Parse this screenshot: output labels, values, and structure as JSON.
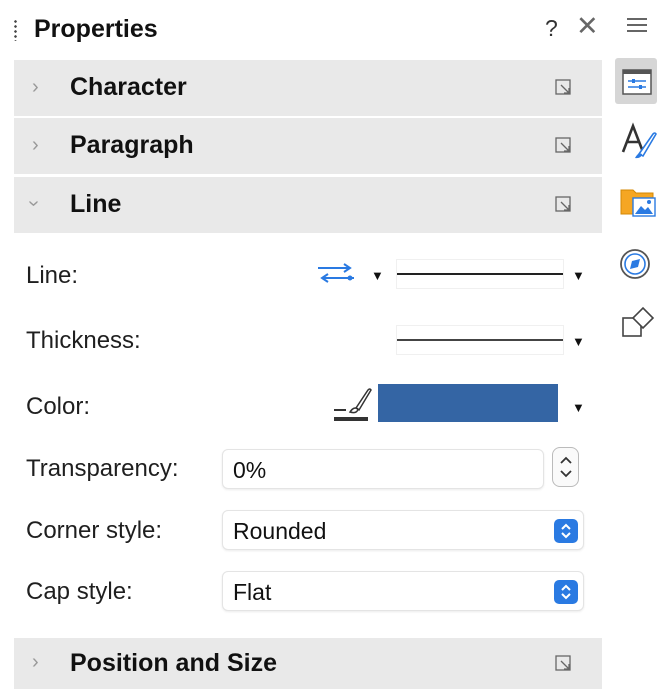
{
  "panel": {
    "title": "Properties",
    "help_label": "?",
    "close_label": "✕"
  },
  "sections": {
    "character": "Character",
    "paragraph": "Paragraph",
    "line": "Line",
    "position_size": "Position and Size"
  },
  "line_section": {
    "line_label": "Line:",
    "thickness_label": "Thickness:",
    "color_label": "Color:",
    "color_value": "#3465a4",
    "transparency_label": "Transparency:",
    "transparency_value": "0%",
    "corner_label": "Corner style:",
    "corner_value": "Rounded",
    "cap_label": "Cap style:",
    "cap_value": "Flat"
  },
  "tabbar": {
    "icons": [
      "menu-icon",
      "properties-icon",
      "styles-icon",
      "gallery-icon",
      "navigator-icon",
      "shapes-icon"
    ]
  }
}
